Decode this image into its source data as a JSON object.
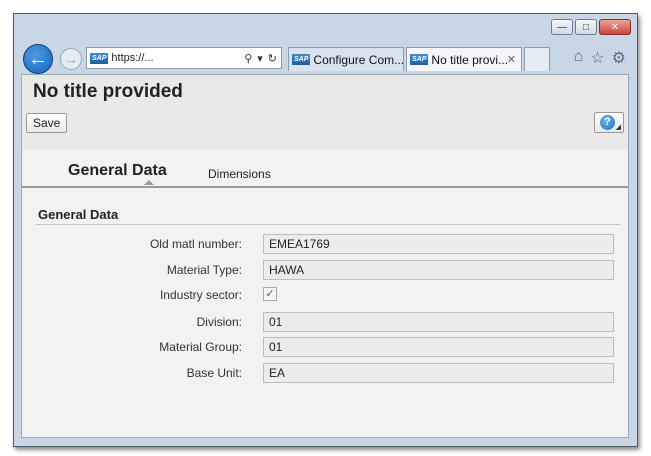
{
  "browser": {
    "address": "https://...",
    "tabs": [
      {
        "label": "Configure Com..."
      },
      {
        "label": "No title provi..."
      }
    ],
    "sap_badge": "SAP"
  },
  "page": {
    "title": "No title provided",
    "save_label": "Save",
    "help_label": "?"
  },
  "tabs": {
    "general": "General Data",
    "dimensions": "Dimensions"
  },
  "section": {
    "title": "General Data"
  },
  "fields": {
    "old_matl_number": {
      "label": "Old matl number:",
      "value": "EMEA1769"
    },
    "material_type": {
      "label": "Material Type:",
      "value": "HAWA"
    },
    "industry_sector": {
      "label": "Industry sector:",
      "checked": true
    },
    "division": {
      "label": "Division:",
      "value": "01"
    },
    "material_group": {
      "label": "Material Group:",
      "value": "01"
    },
    "base_unit": {
      "label": "Base Unit:",
      "value": "EA"
    }
  },
  "colors": {
    "back_button": "#1463b8",
    "header_bg": "#e9e9e9",
    "field_bg": "#ececec"
  }
}
